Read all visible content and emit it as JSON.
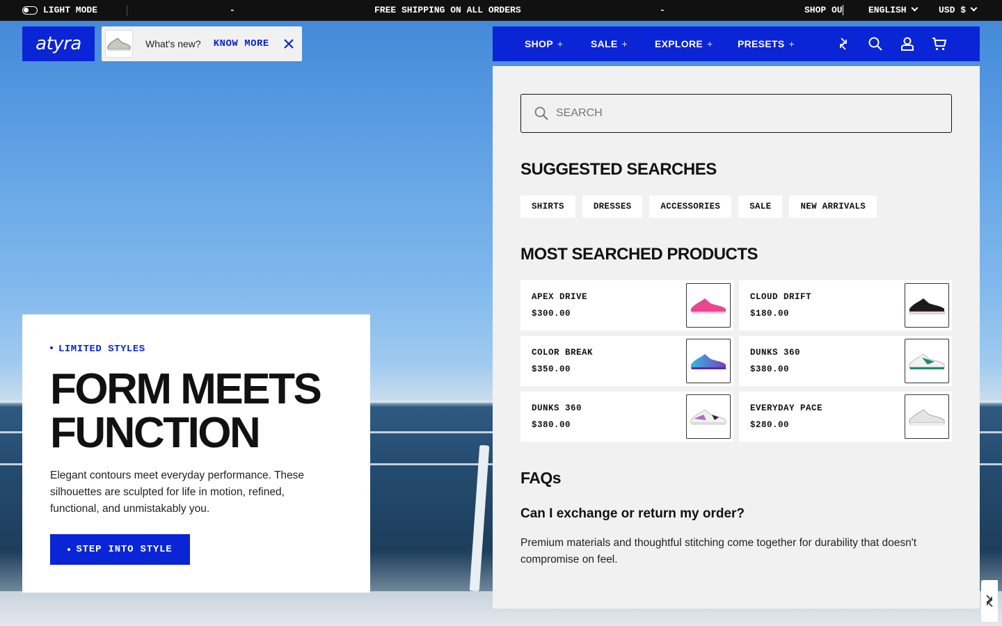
{
  "topbar": {
    "mode_label": "LIGHT MODE",
    "dash_left": "-",
    "announcement": "FREE SHIPPING ON ALL ORDERS",
    "dash_right": "-",
    "shop_ou": "SHOP OU",
    "language": "ENGLISH",
    "currency": "USD $"
  },
  "brand": {
    "logo_text": "atyra"
  },
  "whats_new": {
    "label": "What's new?",
    "link": "KNOW MORE"
  },
  "nav": {
    "items": [
      {
        "label": "SHOP",
        "suffix": "+"
      },
      {
        "label": "SALE",
        "suffix": "+"
      },
      {
        "label": "EXPLORE",
        "suffix": "+"
      },
      {
        "label": "PRESETS",
        "suffix": "+"
      }
    ]
  },
  "search_panel": {
    "placeholder": "SEARCH",
    "suggested_title": "SUGGESTED SEARCHES",
    "suggestions": [
      "SHIRTS",
      "DRESSES",
      "ACCESSORIES",
      "SALE",
      "NEW ARRIVALS"
    ],
    "products_title": "MOST SEARCHED PRODUCTS",
    "products": [
      {
        "name": "APEX DRIVE",
        "price": "$300.00",
        "color": "#e8468f"
      },
      {
        "name": "CLOUD DRIFT",
        "price": "$180.00",
        "color": "#1a1a1a"
      },
      {
        "name": "COLOR BREAK",
        "price": "$350.00",
        "color": "#36b8e0"
      },
      {
        "name": "DUNKS 360",
        "price": "$380.00",
        "color": "#1f8a6c"
      },
      {
        "name": "DUNKS 360",
        "price": "$380.00",
        "color": "#b66bc4"
      },
      {
        "name": "EVERYDAY PACE",
        "price": "$280.00",
        "color": "#d8d8d8"
      }
    ],
    "faq_title": "FAQs",
    "faq_question": "Can I exchange or return my order?",
    "faq_answer": "Premium materials and thoughtful stitching come together for durability that doesn't compromise on feel."
  },
  "hero": {
    "eyebrow": "LIMITED STYLES",
    "title_line1": "FORM MEETS",
    "title_line2": "FUNCTION",
    "description": "Elegant contours meet everyday performance. These silhouettes are sculpted for life in motion, refined, functional, and unmistakably you.",
    "cta": "STEP INTO STYLE"
  },
  "colors": {
    "brand_blue": "#0a25d6",
    "topbar_bg": "#111111",
    "panel_bg": "#f1f1f1"
  }
}
